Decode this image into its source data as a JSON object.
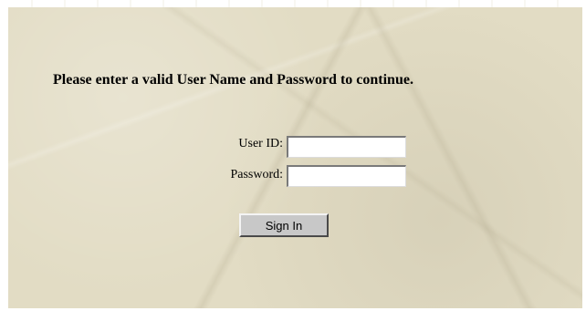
{
  "login": {
    "prompt": "Please enter a valid User Name and Password to continue.",
    "user_id_label": "User ID:",
    "user_id_value": "",
    "password_label": "Password:",
    "password_value": "",
    "sign_in_label": "Sign In"
  },
  "colors": {
    "panel_background": "#e2dcc4",
    "button_face": "#c8c8c8",
    "text": "#000000"
  }
}
